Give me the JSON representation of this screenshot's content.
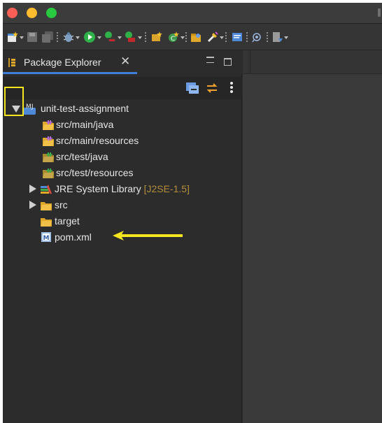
{
  "window": {
    "title_bar": {
      "buttons": [
        "close",
        "minimize",
        "maximize"
      ]
    },
    "colors": {
      "window_bg": "#2b2b2b",
      "sidebar_bg": "#2c2c2c",
      "editor_bg": "#3a3a3a",
      "tab_active_underline": "#3f7fd7",
      "annotation_yellow": "#f5e61f",
      "decoration_text": "#b38d3c"
    }
  },
  "toolbar": {
    "icons": [
      "new-wizard-icon",
      "save-icon",
      "save-all-icon",
      "debug-icon",
      "run-icon",
      "coverage-icon",
      "external-tools-icon",
      "new-java-project-icon",
      "new-java-class-icon",
      "open-type-icon",
      "search-icon",
      "task-icon",
      "mark-occurrences-icon",
      "annotation-icon"
    ]
  },
  "package_explorer": {
    "tab_label": "Package Explorer",
    "tab_close": "✕",
    "view_toolbar": [
      "collapse-all-icon",
      "link-with-editor-icon",
      "view-menu-icon"
    ],
    "tree": {
      "project": {
        "label": "unit-test-assignment",
        "expanded": true
      },
      "items": [
        {
          "label": "src/main/java",
          "kind": "source-folder"
        },
        {
          "label": "src/main/resources",
          "kind": "source-folder"
        },
        {
          "label": "src/test/java",
          "kind": "test-source-folder"
        },
        {
          "label": "src/test/resources",
          "kind": "test-source-folder"
        },
        {
          "label": "JRE System Library",
          "decoration": "[J2SE-1.5]",
          "kind": "library",
          "expandable": true
        },
        {
          "label": "src",
          "kind": "folder",
          "expandable": true
        },
        {
          "label": "target",
          "kind": "folder"
        },
        {
          "label": "pom.xml",
          "kind": "maven-file"
        }
      ]
    }
  },
  "annotations": {
    "highlight_box": "expand-collapse twisty highlighted",
    "arrow_target": "pom.xml"
  }
}
